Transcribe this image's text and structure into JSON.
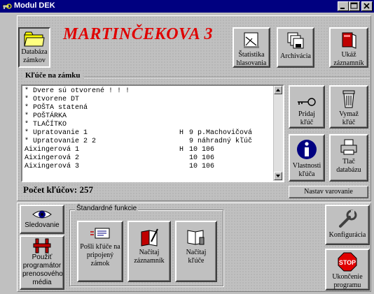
{
  "window": {
    "title": "Modul DEK"
  },
  "header": {
    "title": "MARTINČEKOVA  3"
  },
  "toolbar": {
    "db_label": "Databáza zámkov",
    "stats_label": "Štatistika hlasovania",
    "archive_label": "Archivácia",
    "log_label": "Ukáž záznamník"
  },
  "keys": {
    "section_label": "Kľúče na zámku",
    "rows": [
      {
        "name": "* Dvere sú otvorené ! ! !",
        "code": "",
        "info": ""
      },
      {
        "name": "* Otvorene DT",
        "code": "",
        "info": ""
      },
      {
        "name": "* POŠTA statená",
        "code": "",
        "info": ""
      },
      {
        "name": "* POŠTÁRKA",
        "code": "",
        "info": ""
      },
      {
        "name": "* TLAČÍTKO",
        "code": "",
        "info": ""
      },
      {
        "name": "* Upratovanie 1",
        "code": "H",
        "info": "9 p.Machovičová"
      },
      {
        "name": "* Upratovanie 2 2",
        "code": "",
        "info": "9 náhradný kľúč"
      },
      {
        "name": "Aixingerová 1",
        "code": "H",
        "info": "10 106"
      },
      {
        "name": "Aixingerová 2",
        "code": "",
        "info": "10 106"
      },
      {
        "name": "Aixingerová 3",
        "code": "",
        "info": "10 106"
      }
    ],
    "count_label": "Počet kľúčov: 257"
  },
  "side_actions": {
    "add_key": "Pridaj kľúč",
    "delete_key": "Vymaž kľúč",
    "properties": "Vlastnosti kľúča",
    "print_db": "Tlač databázu",
    "set_warning": "Nastav varovanie"
  },
  "bottom_left": {
    "monitoring": "Sledovanie",
    "use_programmer": "Použiť programátor prenosového média"
  },
  "standard": {
    "caption": "Štandardné funkcie",
    "send_keys": "Pošli kľúče na pripojený zámok",
    "load_log": "Načítaj záznamník",
    "load_keys": "Načítaj kľúče"
  },
  "bottom_right": {
    "configuration": "Konfigurácia",
    "exit": "Ukončenie programu",
    "stop_sign": "STOP"
  },
  "colors": {
    "title_bar": "#000080",
    "accent_red": "#e00000",
    "face": "#c0c0c0"
  }
}
